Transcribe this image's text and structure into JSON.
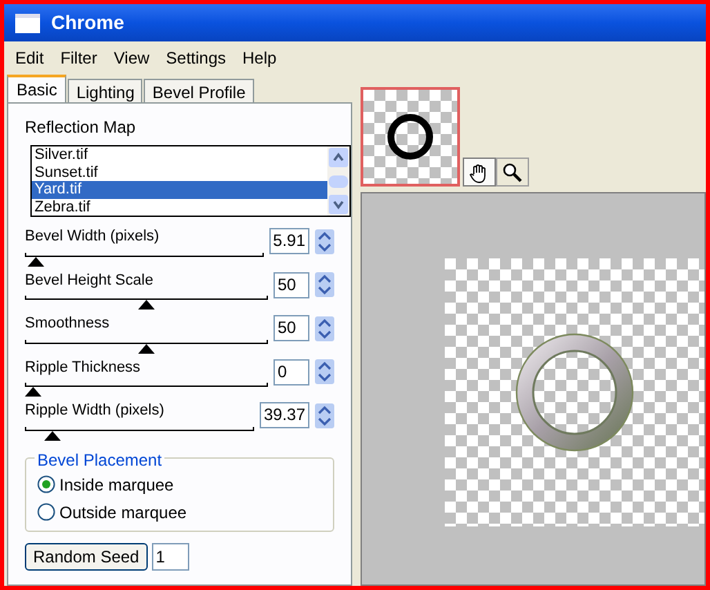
{
  "window": {
    "title": "Chrome"
  },
  "menu": [
    "Edit",
    "Filter",
    "View",
    "Settings",
    "Help"
  ],
  "tabs": [
    {
      "label": "Basic",
      "selected": true
    },
    {
      "label": "Lighting",
      "selected": false
    },
    {
      "label": "Bevel Profile",
      "selected": false
    }
  ],
  "reflection_map": {
    "label": "Reflection Map",
    "items": [
      {
        "label": "Silver.tif",
        "selected": false
      },
      {
        "label": "Sunset.tif",
        "selected": false
      },
      {
        "label": "Yard.tif",
        "selected": true
      },
      {
        "label": "Zebra.tif",
        "selected": false
      }
    ]
  },
  "sliders": [
    {
      "label": "Bevel Width (pixels)",
      "value": "5.91",
      "level": 0.01
    },
    {
      "label": "Bevel Height Scale",
      "value": "50",
      "level": 0.5
    },
    {
      "label": "Smoothness",
      "value": "50",
      "level": 0.5
    },
    {
      "label": "Ripple Thickness",
      "value": "0",
      "level": 0
    },
    {
      "label": "Ripple Width (pixels)",
      "value": "39.37",
      "level": 0.12
    }
  ],
  "bevel_placement": {
    "label": "Bevel Placement",
    "options": [
      {
        "label": "Inside marquee",
        "selected": true
      },
      {
        "label": "Outside marquee",
        "selected": false
      }
    ]
  },
  "random_seed": {
    "label": "Random Seed",
    "value": "1"
  },
  "tools": [
    {
      "kind": "hand",
      "selected": true
    },
    {
      "kind": "zoom",
      "selected": false
    }
  ]
}
